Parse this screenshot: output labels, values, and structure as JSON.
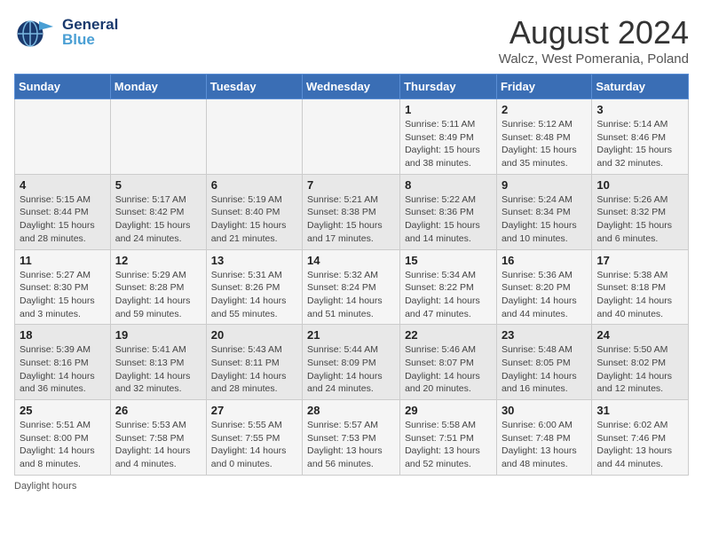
{
  "header": {
    "logo_general": "General",
    "logo_blue": "Blue",
    "month": "August 2024",
    "location": "Walcz, West Pomerania, Poland"
  },
  "days_of_week": [
    "Sunday",
    "Monday",
    "Tuesday",
    "Wednesday",
    "Thursday",
    "Friday",
    "Saturday"
  ],
  "footnote": "Daylight hours",
  "weeks": [
    [
      {
        "day": "",
        "content": ""
      },
      {
        "day": "",
        "content": ""
      },
      {
        "day": "",
        "content": ""
      },
      {
        "day": "",
        "content": ""
      },
      {
        "day": "1",
        "content": "Sunrise: 5:11 AM\nSunset: 8:49 PM\nDaylight: 15 hours\nand 38 minutes."
      },
      {
        "day": "2",
        "content": "Sunrise: 5:12 AM\nSunset: 8:48 PM\nDaylight: 15 hours\nand 35 minutes."
      },
      {
        "day": "3",
        "content": "Sunrise: 5:14 AM\nSunset: 8:46 PM\nDaylight: 15 hours\nand 32 minutes."
      }
    ],
    [
      {
        "day": "4",
        "content": "Sunrise: 5:15 AM\nSunset: 8:44 PM\nDaylight: 15 hours\nand 28 minutes."
      },
      {
        "day": "5",
        "content": "Sunrise: 5:17 AM\nSunset: 8:42 PM\nDaylight: 15 hours\nand 24 minutes."
      },
      {
        "day": "6",
        "content": "Sunrise: 5:19 AM\nSunset: 8:40 PM\nDaylight: 15 hours\nand 21 minutes."
      },
      {
        "day": "7",
        "content": "Sunrise: 5:21 AM\nSunset: 8:38 PM\nDaylight: 15 hours\nand 17 minutes."
      },
      {
        "day": "8",
        "content": "Sunrise: 5:22 AM\nSunset: 8:36 PM\nDaylight: 15 hours\nand 14 minutes."
      },
      {
        "day": "9",
        "content": "Sunrise: 5:24 AM\nSunset: 8:34 PM\nDaylight: 15 hours\nand 10 minutes."
      },
      {
        "day": "10",
        "content": "Sunrise: 5:26 AM\nSunset: 8:32 PM\nDaylight: 15 hours\nand 6 minutes."
      }
    ],
    [
      {
        "day": "11",
        "content": "Sunrise: 5:27 AM\nSunset: 8:30 PM\nDaylight: 15 hours\nand 3 minutes."
      },
      {
        "day": "12",
        "content": "Sunrise: 5:29 AM\nSunset: 8:28 PM\nDaylight: 14 hours\nand 59 minutes."
      },
      {
        "day": "13",
        "content": "Sunrise: 5:31 AM\nSunset: 8:26 PM\nDaylight: 14 hours\nand 55 minutes."
      },
      {
        "day": "14",
        "content": "Sunrise: 5:32 AM\nSunset: 8:24 PM\nDaylight: 14 hours\nand 51 minutes."
      },
      {
        "day": "15",
        "content": "Sunrise: 5:34 AM\nSunset: 8:22 PM\nDaylight: 14 hours\nand 47 minutes."
      },
      {
        "day": "16",
        "content": "Sunrise: 5:36 AM\nSunset: 8:20 PM\nDaylight: 14 hours\nand 44 minutes."
      },
      {
        "day": "17",
        "content": "Sunrise: 5:38 AM\nSunset: 8:18 PM\nDaylight: 14 hours\nand 40 minutes."
      }
    ],
    [
      {
        "day": "18",
        "content": "Sunrise: 5:39 AM\nSunset: 8:16 PM\nDaylight: 14 hours\nand 36 minutes."
      },
      {
        "day": "19",
        "content": "Sunrise: 5:41 AM\nSunset: 8:13 PM\nDaylight: 14 hours\nand 32 minutes."
      },
      {
        "day": "20",
        "content": "Sunrise: 5:43 AM\nSunset: 8:11 PM\nDaylight: 14 hours\nand 28 minutes."
      },
      {
        "day": "21",
        "content": "Sunrise: 5:44 AM\nSunset: 8:09 PM\nDaylight: 14 hours\nand 24 minutes."
      },
      {
        "day": "22",
        "content": "Sunrise: 5:46 AM\nSunset: 8:07 PM\nDaylight: 14 hours\nand 20 minutes."
      },
      {
        "day": "23",
        "content": "Sunrise: 5:48 AM\nSunset: 8:05 PM\nDaylight: 14 hours\nand 16 minutes."
      },
      {
        "day": "24",
        "content": "Sunrise: 5:50 AM\nSunset: 8:02 PM\nDaylight: 14 hours\nand 12 minutes."
      }
    ],
    [
      {
        "day": "25",
        "content": "Sunrise: 5:51 AM\nSunset: 8:00 PM\nDaylight: 14 hours\nand 8 minutes."
      },
      {
        "day": "26",
        "content": "Sunrise: 5:53 AM\nSunset: 7:58 PM\nDaylight: 14 hours\nand 4 minutes."
      },
      {
        "day": "27",
        "content": "Sunrise: 5:55 AM\nSunset: 7:55 PM\nDaylight: 14 hours\nand 0 minutes."
      },
      {
        "day": "28",
        "content": "Sunrise: 5:57 AM\nSunset: 7:53 PM\nDaylight: 13 hours\nand 56 minutes."
      },
      {
        "day": "29",
        "content": "Sunrise: 5:58 AM\nSunset: 7:51 PM\nDaylight: 13 hours\nand 52 minutes."
      },
      {
        "day": "30",
        "content": "Sunrise: 6:00 AM\nSunset: 7:48 PM\nDaylight: 13 hours\nand 48 minutes."
      },
      {
        "day": "31",
        "content": "Sunrise: 6:02 AM\nSunset: 7:46 PM\nDaylight: 13 hours\nand 44 minutes."
      }
    ]
  ]
}
